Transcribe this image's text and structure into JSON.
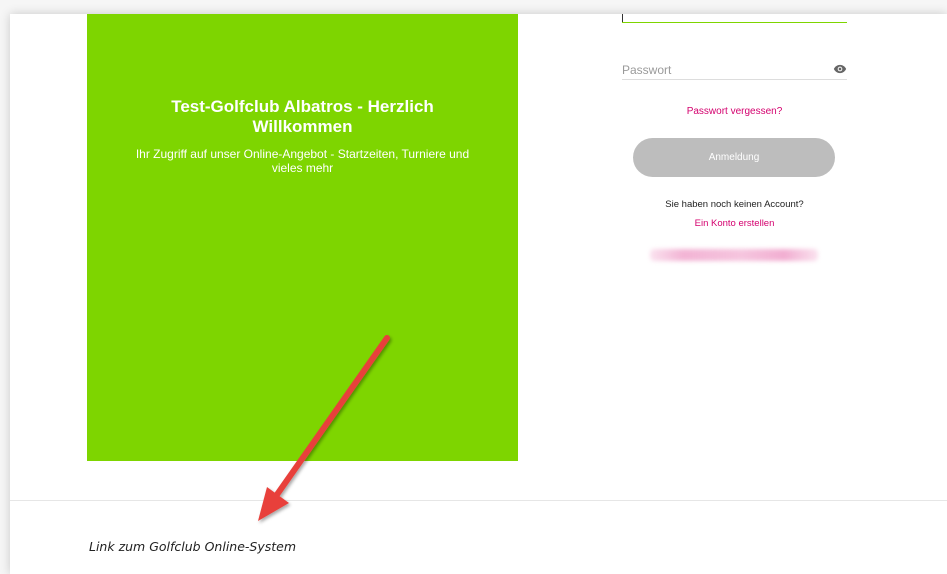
{
  "hero": {
    "title": "Test-Golfclub Albatros - Herzlich Willkommen",
    "subtitle": "Ihr Zugriff auf unser Online-Angebot - Startzeiten, Turniere und vieles mehr",
    "color": "#7ed500"
  },
  "login": {
    "password_placeholder": "Passwort",
    "password_value": "",
    "show_password_icon": "eye-icon",
    "forgot_password_label": "Passwort vergessen?",
    "login_button_label": "Anmeldung",
    "no_account_text": "Sie haben noch keinen Account?",
    "create_account_label": "Ein Konto erstellen",
    "link_color": "#d4006e",
    "button_color": "#bdbdbd"
  },
  "footer": {
    "link_label": "Link zum Golfclub Online-System"
  },
  "annotation": {
    "arrow_color": "#e8413b",
    "arrow_icon": "arrow-annotation-icon"
  }
}
